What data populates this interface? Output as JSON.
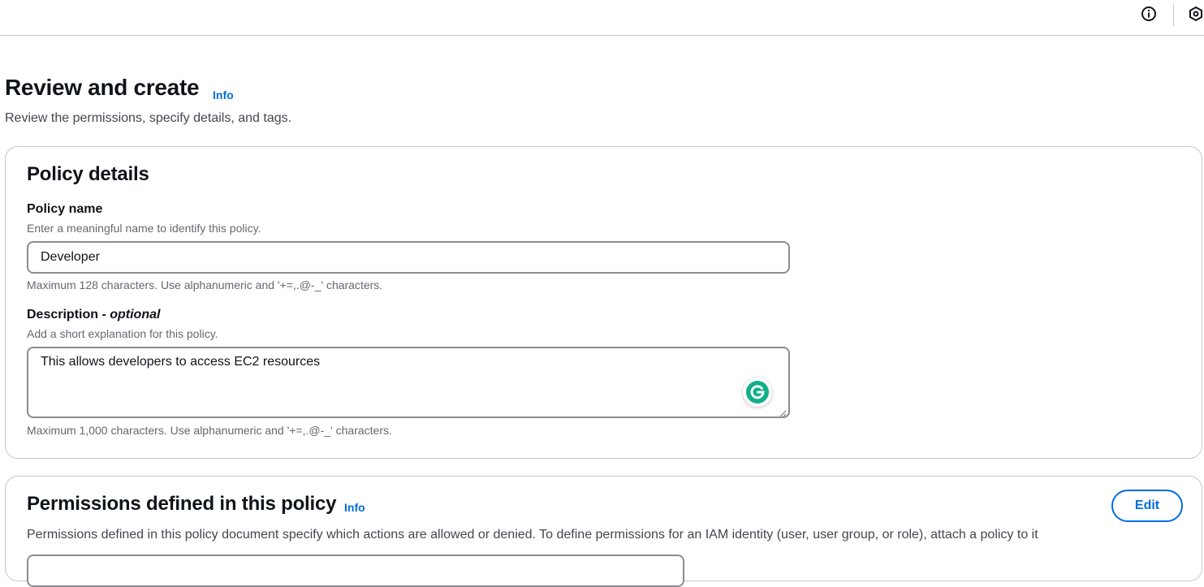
{
  "topbar": {
    "info_icon": "info-circle-icon",
    "settings_icon": "settings-hex-icon"
  },
  "header": {
    "title": "Review and create",
    "info_link": "Info",
    "description": "Review the permissions, specify details, and tags."
  },
  "policy_details": {
    "title": "Policy details",
    "name": {
      "label": "Policy name",
      "description": "Enter a meaningful name to identify this policy.",
      "value": "Developer",
      "constraint": "Maximum 128 characters. Use alphanumeric and '+=,.@-_' characters."
    },
    "description": {
      "label": "Description - ",
      "label_optional": "optional",
      "description": "Add a short explanation for this policy.",
      "value": "This allows developers to access EC2 resources",
      "constraint": "Maximum 1,000 characters. Use alphanumeric and '+=,.@-_' characters."
    }
  },
  "permissions": {
    "title": "Permissions defined in this policy",
    "info_link": "Info",
    "edit_label": "Edit",
    "description": "Permissions defined in this policy document specify which actions are allowed or denied. To define permissions for an IAM identity (user, user group, or role), attach a policy to it"
  },
  "colors": {
    "link": "#006ce0",
    "border": "#c6c6cd",
    "input_border": "#8c8c94",
    "grammarly": "#15c39a"
  }
}
